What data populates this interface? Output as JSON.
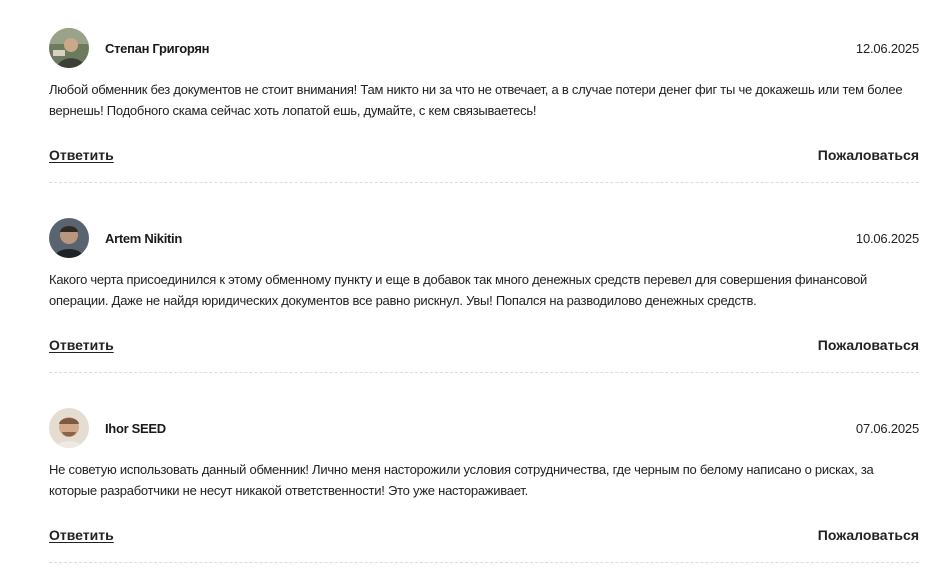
{
  "comments": [
    {
      "author": "Степан Григорян",
      "date": "12.06.2025",
      "text": "Любой обменник без документов не стоит внимания! Там никто ни за что не отвечает, а в случае потери денег фиг ты че докажешь или тем более вернешь! Подобного скама сейчас хоть лопатой ешь, думайте, с кем связываетесь!",
      "reply_label": "Ответить",
      "report_label": "Пожаловаться"
    },
    {
      "author": "Artem Nikitin",
      "date": "10.06.2025",
      "text": "Какого черта присоединился к этому обменному пункту и еще в добавок так много денежных средств перевел для совершения финансовой операции. Даже не найдя юридических документов все равно рискнул. Увы! Попался на разводилово денежных средств.",
      "reply_label": "Ответить",
      "report_label": "Пожаловаться"
    },
    {
      "author": "Ihor SEED",
      "date": "07.06.2025",
      "text": "Не советую использовать данный обменник! Лично меня насторожили условия сотрудничества, где черным по белому написано о рисках, за которые разработчики не несут никакой ответственности! Это уже настораживает.",
      "reply_label": "Ответить",
      "report_label": "Пожаловаться"
    }
  ]
}
